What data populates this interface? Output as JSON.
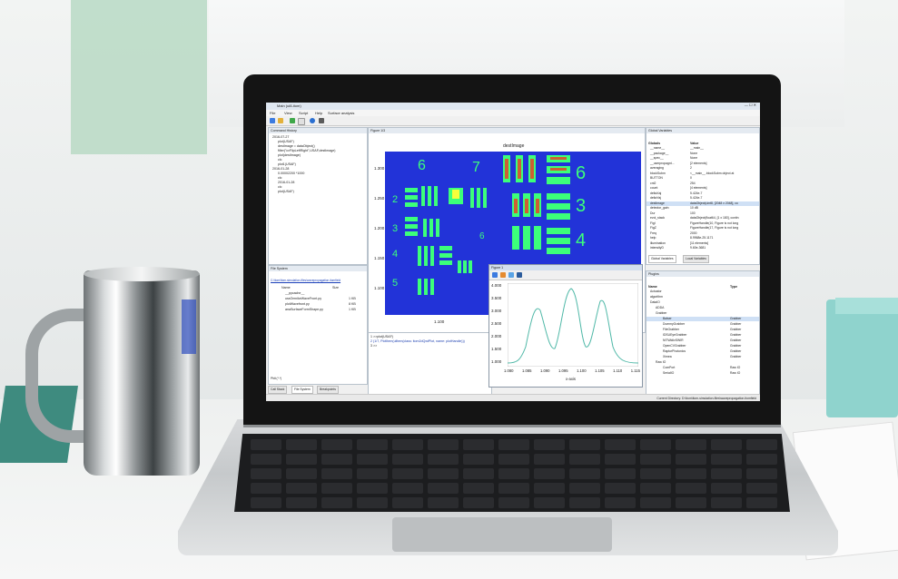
{
  "window": {
    "title": "Main (ui8-itom)"
  },
  "menu": [
    "File",
    "View",
    "Script",
    "Help",
    "Surface analysis"
  ],
  "command_history": {
    "title": "Command History",
    "lines": [
      "2016-07-27",
      "plot(USAF)",
      "destImage = dataObject()",
      "filter(\"cvFlipLeftRight\",USAF,destImage)",
      "plot(destImage)",
      "clc",
      "plot1(USAF)",
      "2016-01-28",
      "0.00002200 *1000",
      "clc",
      "2016-01-28",
      "clc",
      "plot(USAF)"
    ]
  },
  "file_system": {
    "title": "File System",
    "path": "C:\\itom\\itom-simulation-files\\wavepropagation.itomfield",
    "col_name": "Name",
    "col_size": "Size",
    "files": [
      {
        "name": "__pycache__",
        "size": ""
      },
      {
        "name": "useZernikeWaveFront.py",
        "size": "1 KB"
      },
      {
        "name": "plotWavefront.py",
        "size": "8 KB"
      },
      {
        "name": "anaSurfaceFormShape.py",
        "size": "1 KB"
      }
    ],
    "filter": "Pfdt (*.*)"
  },
  "tabs": {
    "callstack": "Call Stack",
    "filesystem": "File System",
    "breakpoints": "Breakpoints"
  },
  "figure": {
    "title": "Figure 1/3",
    "image_title": "destImage",
    "y_ticks": [
      "1.300",
      "1.250",
      "1.200",
      "1.150",
      "1.100"
    ],
    "x_tick": "1.100",
    "numbers": [
      "6",
      "7",
      "2",
      "3",
      "4",
      "5",
      "6",
      "3",
      "4",
      "5",
      "6"
    ]
  },
  "console": {
    "lines": [
      "1 >>plot(USAF)",
      "2 (1/7, PlotItem(uiItem(class: itom2dQwtPlot, name: plotHandle)))",
      "3 >>"
    ]
  },
  "plot_window": {
    "title": "Figure 1",
    "y_ticks": [
      "4.000",
      "3.500",
      "3.000",
      "2.500",
      "2.000",
      "1.500",
      "1.000"
    ],
    "x_ticks": [
      "1.080",
      "1.085",
      "1.090",
      "1.095",
      "1.100",
      "1.105",
      "1.110",
      "1.115"
    ],
    "x_label": "x-axis"
  },
  "global_variables": {
    "title": "Global Variables",
    "col_name": "Globals",
    "col_value": "Value",
    "rows": [
      [
        "__name__",
        "__main__"
      ],
      [
        "__package__",
        "None"
      ],
      [
        "__spec__",
        "None"
      ],
      [
        "__userpropagnt...",
        "[2 elements]"
      ],
      [
        "averaging",
        "2"
      ],
      [
        "blockSubm",
        "<__main__.blockSubm object at"
      ],
      [
        "BUTTON",
        "0"
      ],
      [
        "cnt2",
        "254"
      ],
      [
        "count",
        "[4 elements]"
      ],
      [
        "deltaXaj",
        "5.424e-7"
      ],
      [
        "deltaYaj",
        "5.424e-7"
      ],
      [
        "destImage",
        "dataObject(uint8, [2048 x 2048], co"
      ],
      [
        "detector_gain",
        "10 dB"
      ],
      [
        "Dur",
        "100"
      ],
      [
        "evol_stack",
        "dataObject(float64, [1 x 180], contin"
      ],
      [
        "FigI",
        "FigureHandle(10, Figure is not long"
      ],
      [
        "FigZ",
        "FigureHandle(17, Figure is not long"
      ],
      [
        "Freq",
        "2000"
      ],
      [
        "help",
        "8.9968e-25.1171"
      ],
      [
        "illumination",
        "[11 elements]"
      ],
      [
        "intensityD",
        "9.60e-3681"
      ]
    ],
    "tab_global": "Global Variables",
    "tab_local": "Local Variables"
  },
  "plugins": {
    "title": "Plugins",
    "col_name": "Name",
    "col_type": "Type",
    "rows": [
      [
        "Actuator",
        ""
      ],
      [
        "algorithm",
        ""
      ],
      [
        "DataIO",
        ""
      ],
      [
        "ADDA",
        ""
      ],
      [
        "Grabber",
        ""
      ],
      [
        "Balser",
        "Grabber"
      ],
      [
        "DummyGrabber",
        "Grabber"
      ],
      [
        "FileGrabber",
        "Grabber"
      ],
      [
        "IDSUEyeGrabber",
        "Grabber"
      ],
      [
        "NITWidivSWIR",
        "Grabber"
      ],
      [
        "OpenCVGrabber",
        "Grabber"
      ],
      [
        "RaptorPhotonics",
        "Grabber"
      ],
      [
        "Ximea",
        "Grabber"
      ],
      [
        "Raw IO",
        ""
      ],
      [
        "ComPort",
        "Raw IO"
      ],
      [
        "SerialIO",
        "Raw IO"
      ]
    ]
  },
  "status": {
    "text": "Current Directory: D:\\itom\\itom-simulation-files\\wavepropagation.itomfield"
  },
  "colors": {
    "image_bg": "#2233d8",
    "bar": "#3cff7a",
    "hot": "#ff2a1a",
    "curve": "#4fb8a7"
  }
}
